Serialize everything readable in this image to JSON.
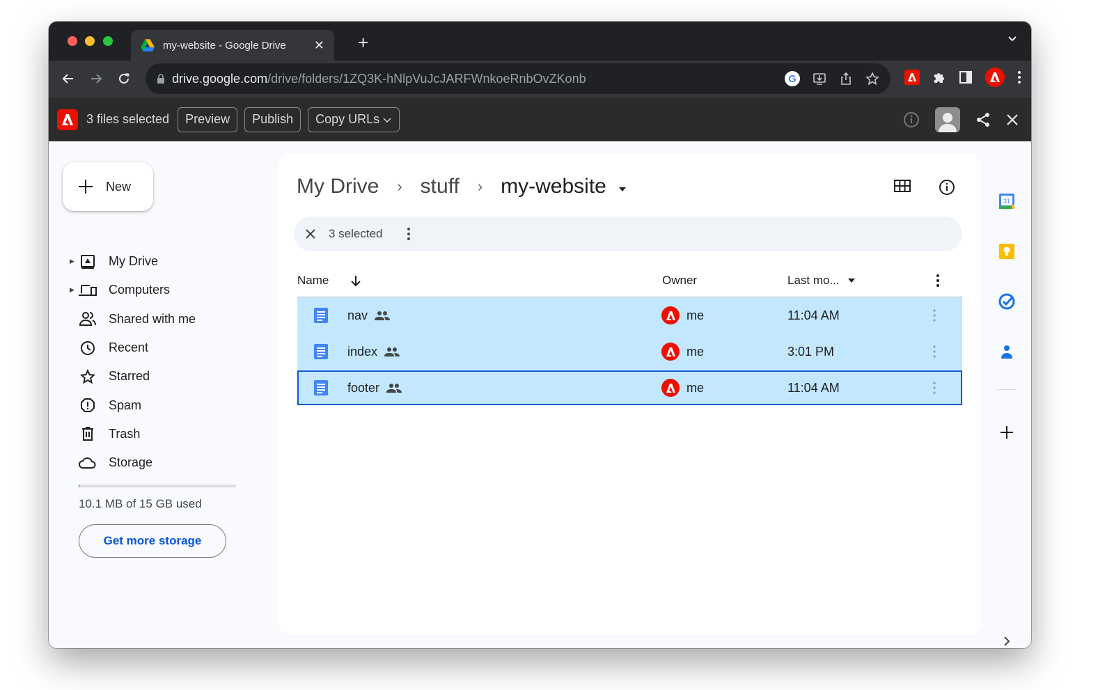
{
  "browser": {
    "tab_title": "my-website - Google Drive",
    "url_host": "drive.google.com",
    "url_path": "/drive/folders/1ZQ3K-hNlpVuJcJARFWnkoeRnbOvZKonb"
  },
  "extension_bar": {
    "status": "3 files selected",
    "buttons": [
      "Preview",
      "Publish",
      "Copy URLs"
    ]
  },
  "drive": {
    "new_label": "New",
    "nav": [
      {
        "label": "My Drive",
        "icon": "my-drive-icon",
        "expandable": true
      },
      {
        "label": "Computers",
        "icon": "computers-icon",
        "expandable": true
      },
      {
        "label": "Shared with me",
        "icon": "shared-icon",
        "expandable": false
      },
      {
        "label": "Recent",
        "icon": "clock-icon",
        "expandable": false
      },
      {
        "label": "Starred",
        "icon": "star-icon",
        "expandable": false
      },
      {
        "label": "Spam",
        "icon": "spam-icon",
        "expandable": false
      },
      {
        "label": "Trash",
        "icon": "trash-icon",
        "expandable": false
      },
      {
        "label": "Storage",
        "icon": "cloud-icon",
        "expandable": false
      }
    ],
    "storage": {
      "used_text": "10.1 MB of 15 GB used",
      "used_fraction": 0.0007,
      "cta": "Get more storage"
    },
    "breadcrumb": [
      "My Drive",
      "stuff",
      "my-website"
    ],
    "selection": {
      "count_label": "3 selected"
    },
    "columns": {
      "name": "Name",
      "owner": "Owner",
      "modified": "Last mo..."
    },
    "files": [
      {
        "name": "nav",
        "owner": "me",
        "modified": "11:04 AM",
        "shared": true
      },
      {
        "name": "index",
        "owner": "me",
        "modified": "3:01 PM",
        "shared": true
      },
      {
        "name": "footer",
        "owner": "me",
        "modified": "11:04 AM",
        "shared": true
      }
    ]
  },
  "colors": {
    "selected_row": "#c2e7ff",
    "focus_outline": "#0b57d0",
    "adobe_red": "#eb1000",
    "doc_blue": "#4285f4"
  }
}
